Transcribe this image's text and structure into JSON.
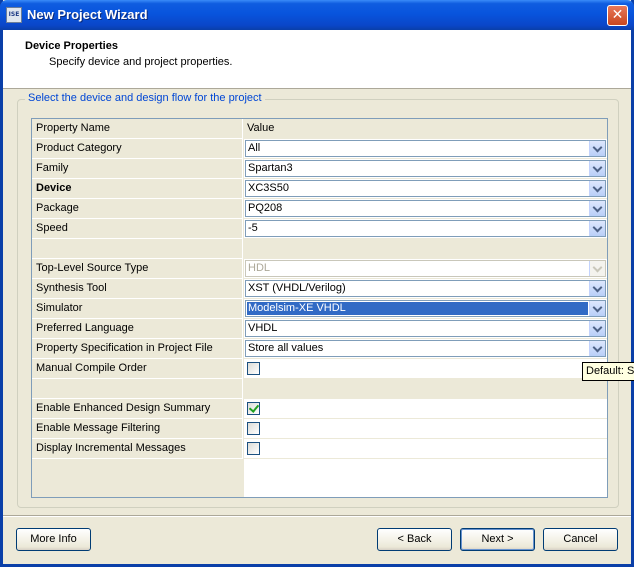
{
  "window": {
    "title": "New Project Wizard",
    "icon": "ise-app-icon",
    "close_label": "✕"
  },
  "header": {
    "title": "Device Properties",
    "subtitle": "Specify device and project properties."
  },
  "group": {
    "label": "Select the device and design flow for the project"
  },
  "grid": {
    "columns": [
      "Property Name",
      "Value"
    ],
    "rows": [
      {
        "name": "Product Category",
        "value": "All",
        "type": "combo"
      },
      {
        "name": "Family",
        "value": "Spartan3",
        "type": "combo"
      },
      {
        "name": "Device",
        "value": "XC3S50",
        "type": "combo",
        "bold": true
      },
      {
        "name": "Package",
        "value": "PQ208",
        "type": "combo"
      },
      {
        "name": "Speed",
        "value": "-5",
        "type": "combo"
      },
      {
        "name": "",
        "value": "",
        "type": "blank"
      },
      {
        "name": "Top-Level Source Type",
        "value": "HDL",
        "type": "combo",
        "disabled": true
      },
      {
        "name": "Synthesis Tool",
        "value": "XST (VHDL/Verilog)",
        "type": "combo"
      },
      {
        "name": "Simulator",
        "value": "Modelsim-XE VHDL",
        "type": "combo",
        "selected": true
      },
      {
        "name": "Preferred Language",
        "value": "VHDL",
        "type": "combo"
      },
      {
        "name": "Property Specification in Project File",
        "value": "Store all values",
        "type": "combo"
      },
      {
        "name": "Manual Compile Order",
        "value": false,
        "type": "checkbox"
      },
      {
        "name": "",
        "value": "",
        "type": "blank"
      },
      {
        "name": "Enable Enhanced Design Summary",
        "value": true,
        "type": "checkbox"
      },
      {
        "name": "Enable Message Filtering",
        "value": false,
        "type": "checkbox"
      },
      {
        "name": "Display Incremental Messages",
        "value": false,
        "type": "checkbox"
      }
    ]
  },
  "tooltip": {
    "text": "Default: St"
  },
  "buttons": {
    "more_info": "More Info",
    "back": "< Back",
    "next": "Next >",
    "cancel": "Cancel"
  },
  "colors": {
    "selection": "#316ac5",
    "title_bar": "#0854dd",
    "group_label": "#0046d5"
  }
}
